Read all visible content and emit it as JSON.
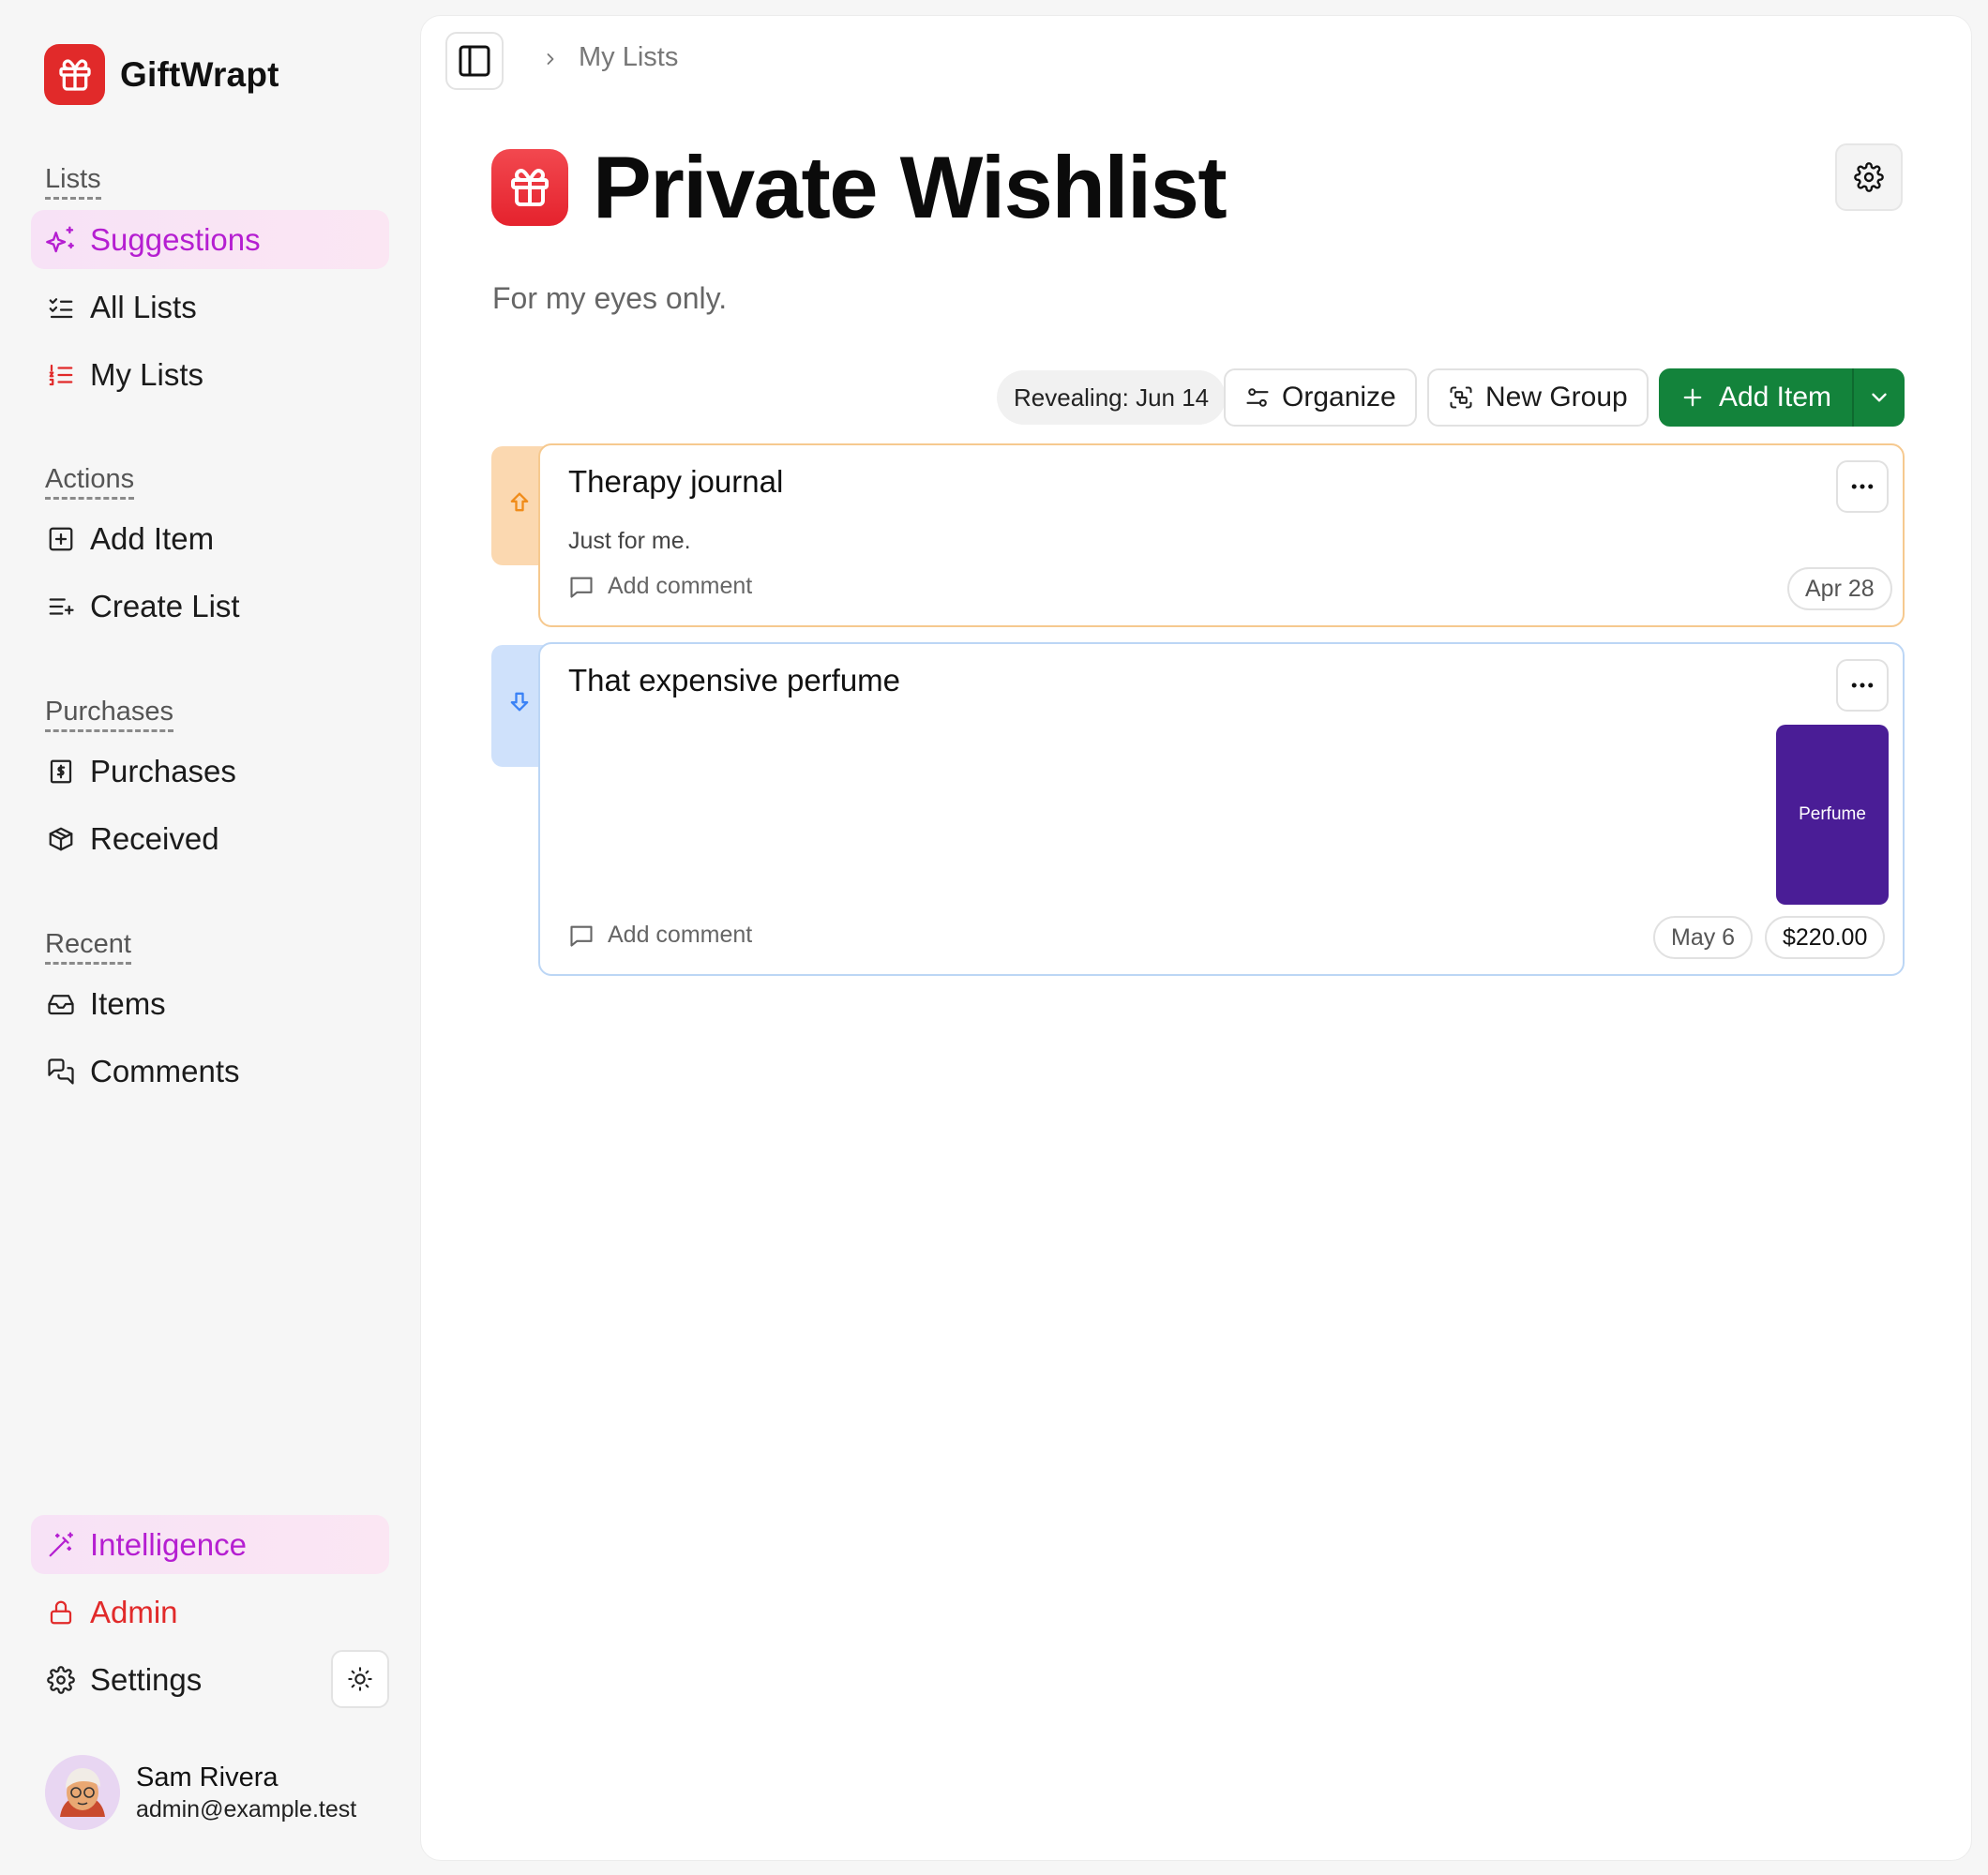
{
  "brand": {
    "name": "GiftWrapt"
  },
  "sidebar": {
    "lists_title": "Lists",
    "lists": [
      {
        "label": "Suggestions",
        "icon": "sparkles-icon",
        "active": true
      },
      {
        "label": "All Lists",
        "icon": "list-checks-icon"
      },
      {
        "label": "My Lists",
        "icon": "list-ordered-icon"
      }
    ],
    "actions_title": "Actions",
    "actions": [
      {
        "label": "Add Item",
        "icon": "plus-square-icon"
      },
      {
        "label": "Create List",
        "icon": "list-plus-icon"
      }
    ],
    "purchases_title": "Purchases",
    "purchases": [
      {
        "label": "Purchases",
        "icon": "receipt-dollar-icon"
      },
      {
        "label": "Received",
        "icon": "package-icon"
      }
    ],
    "recent_title": "Recent",
    "recent": [
      {
        "label": "Items",
        "icon": "inbox-icon"
      },
      {
        "label": "Comments",
        "icon": "messages-icon"
      }
    ],
    "bottom": [
      {
        "label": "Intelligence",
        "icon": "magic-wand-icon",
        "active": true
      },
      {
        "label": "Admin",
        "icon": "lock-icon",
        "color": "#e12a2a"
      },
      {
        "label": "Settings",
        "icon": "gear-icon"
      }
    ]
  },
  "user": {
    "name": "Sam Rivera",
    "email": "admin@example.test"
  },
  "breadcrumb": {
    "current": "My Lists"
  },
  "list": {
    "title": "Private Wishlist",
    "description": "For my eyes only.",
    "reveal_badge": "Revealing: Jun 14"
  },
  "toolbar": {
    "organize": "Organize",
    "new_group": "New Group",
    "add_item": "Add Item"
  },
  "items": [
    {
      "title": "Therapy journal",
      "notes": "Just for me.",
      "comment_label": "Add comment",
      "date": "Apr 28",
      "priority": "high",
      "priority_color": "#f5a623"
    },
    {
      "title": "That expensive perfume",
      "notes": "",
      "comment_label": "Add comment",
      "date": "May 6",
      "price": "$220.00",
      "image_label": "Perfume",
      "priority": "low",
      "priority_color": "#3b82f6"
    }
  ],
  "colors": {
    "brand_red": "#e12a2a",
    "accent_magenta": "#b51ed1",
    "add_green": "#13833b",
    "perfume_purple": "#4a1d96"
  }
}
